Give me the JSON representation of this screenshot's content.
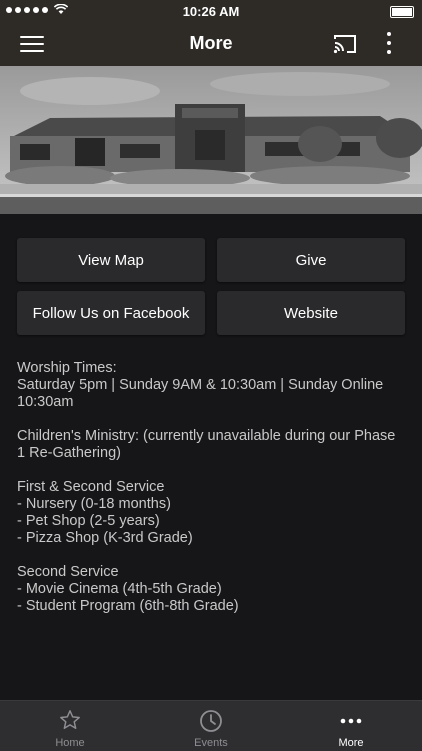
{
  "status_bar": {
    "time": "10:26 AM"
  },
  "nav": {
    "title": "More"
  },
  "buttons": {
    "view_map": "View Map",
    "give": "Give",
    "facebook": "Follow Us on Facebook",
    "website": "Website"
  },
  "info": {
    "worship": "Worship Times:\nSaturday 5pm | Sunday 9AM & 10:30am | Sunday Online 10:30am",
    "childrens": "Children's  Ministry: (currently unavailable during our Phase 1 Re-Gathering)",
    "first_second": "First & Second Service\n - Nursery (0-18 months)\n - Pet Shop (2-5 years)\n - Pizza Shop (K-3rd Grade)",
    "second": "Second Service\n - Movie Cinema (4th-5th Grade)\n- Student Program (6th-8th Grade)"
  },
  "tabs": [
    {
      "label": "Home",
      "icon": "star-icon"
    },
    {
      "label": "Events",
      "icon": "clock-icon"
    },
    {
      "label": "More",
      "icon": "more-dots-icon"
    }
  ],
  "colors": {
    "bar": "#2e2b27",
    "background": "#161618",
    "button": "#2a2a2c"
  }
}
